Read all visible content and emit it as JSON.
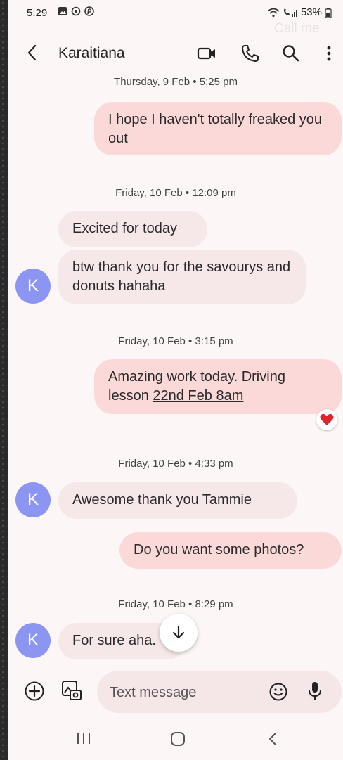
{
  "status_bar": {
    "time": "5:29",
    "battery": "53%"
  },
  "ghost_text": "Call me",
  "header": {
    "contact_name": "Karaitiana"
  },
  "conversation": {
    "date_1": "Thursday, 9 Feb • 5:25 pm",
    "msg_1": "I hope I haven't totally freaked you out",
    "date_2": "Friday, 10 Feb • 12:09 pm",
    "msg_2": "Excited for today",
    "msg_3": "btw thank you for the savourys and donuts hahaha",
    "date_3": "Friday, 10 Feb • 3:15 pm",
    "msg_4_text": "Amazing work today. Driving lesson ",
    "msg_4_link": "22nd Feb 8am",
    "msg_4_reaction": "heart",
    "date_4": "Friday, 10 Feb • 4:33 pm",
    "msg_5": "Awesome thank you Tammie",
    "msg_6": "Do you want some photos?",
    "date_5": "Friday, 10 Feb • 8:29 pm",
    "msg_7": "For sure aha.",
    "avatar_initial": "K"
  },
  "composer": {
    "placeholder": "Text message"
  },
  "colors": {
    "outgoing_bubble": "#fbd9d9",
    "incoming_bubble": "#f6e8e8",
    "avatar": "#8c95f2",
    "background": "#fcf6f6"
  },
  "icons": [
    "back-arrow-icon",
    "video-call-icon",
    "phone-icon",
    "search-icon",
    "more-vert-icon",
    "add-icon",
    "gallery-icon",
    "emoji-icon",
    "mic-icon",
    "scroll-down-icon",
    "heart-icon",
    "recents-icon",
    "home-icon",
    "back-nav-icon"
  ]
}
